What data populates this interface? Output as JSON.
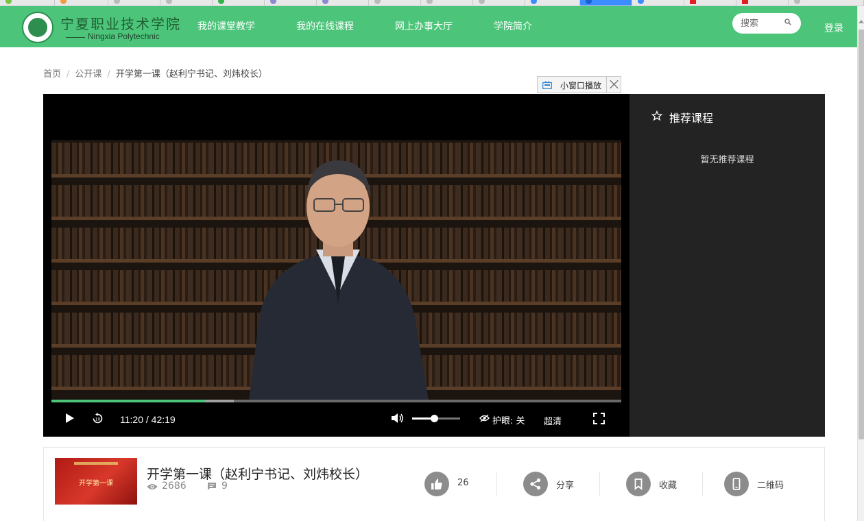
{
  "header": {
    "logo_cn": "宁夏职业技术学院",
    "logo_en": "Ningxia Polytechnic",
    "nav": [
      {
        "label": "我的课堂教学"
      },
      {
        "label": "我的在线课程"
      },
      {
        "label": "网上办事大厅"
      },
      {
        "label": "学院简介"
      }
    ],
    "search_placeholder": "搜索",
    "login_label": "登录"
  },
  "breadcrumb": {
    "home": "首页",
    "section": "公开课",
    "current": "开学第一课（赵利宁书记、刘炜校长）"
  },
  "miniwindow": {
    "label": "小窗口播放"
  },
  "player": {
    "current_time": "11:20",
    "separator": "/",
    "duration": "42:19",
    "progress_played_fraction": 0.27,
    "progress_buffered_fraction": 0.32,
    "volume_fraction": 0.45,
    "eye_care_label": "护眼: 关",
    "quality_label": "超清"
  },
  "recommend": {
    "title": "推荐课程",
    "empty_text": "暂无推荐课程"
  },
  "course": {
    "thumbnail_text": "开学第一课",
    "title": "开学第一课（赵利宁书记、刘炜校长）",
    "views": "2686",
    "comments": "9",
    "likes": "26",
    "share_label": "分享",
    "favorite_label": "收藏",
    "qrcode_label": "二维码"
  },
  "colors": {
    "brand_green": "#4cc57a",
    "player_bg": "#000000",
    "panel_bg": "#232323",
    "action_icon_bg": "#8c8c8c"
  }
}
